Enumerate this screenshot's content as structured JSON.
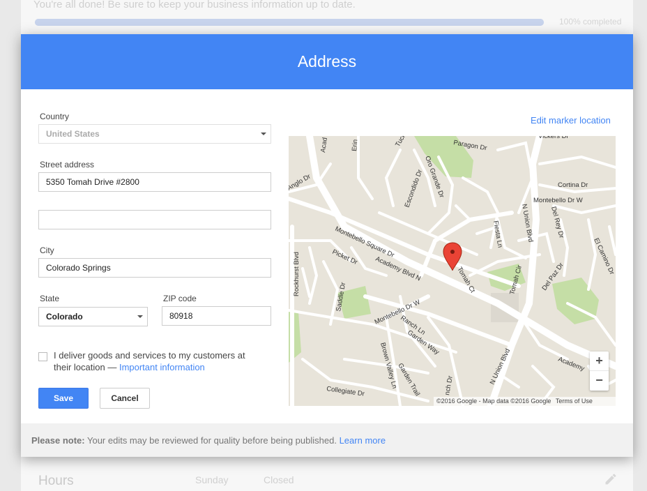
{
  "background": {
    "top_text": "You're all done! Be sure to keep your business information up to date.",
    "progress_percent": 100,
    "progress_label": "100% completed",
    "hours_title": "Hours",
    "hours_day": "Sunday",
    "hours_value": "Closed"
  },
  "dialog": {
    "title": "Address",
    "country": {
      "label": "Country",
      "value": "United States"
    },
    "street": {
      "label": "Street address",
      "value": "5350 Tomah Drive #2800",
      "value2": ""
    },
    "city": {
      "label": "City",
      "value": "Colorado Springs"
    },
    "state": {
      "label": "State",
      "value": "Colorado"
    },
    "zip": {
      "label": "ZIP code",
      "value": "80918"
    },
    "delivery": {
      "text": "I deliver goods and services to my customers at their location —",
      "link": "Important information",
      "checked": false
    },
    "save_label": "Save",
    "cancel_label": "Cancel",
    "edit_marker_label": "Edit marker location",
    "map": {
      "streets": [
        "Academy Blvd N",
        "Montebello Square Dr",
        "Montebello Dr W",
        "Rockhurst Blvd",
        "Picket Dr",
        "Saddle Dr",
        "Ranch Ln",
        "Garden Way",
        "Brown Valley Ln",
        "Garden Trail",
        "Collegiate Dr",
        "N Union Blvd",
        "Tomah Ct",
        "Tomah Cir",
        "Fiesta Ln",
        "Del Rey Dr",
        "Del Paz Dr",
        "El Camino Dr",
        "Cortina Dr",
        "Montebello Dr W",
        "Vickers Dr",
        "Paragon Dr",
        "Oro Grande Dr",
        "Escondido Dr",
        "Tucker",
        "Erin",
        "Acad",
        "Anglo Dr",
        "nch Dr"
      ],
      "credit": "©2016 Google - Map data ©2016 Google",
      "terms": "Terms of Use",
      "marker_color": "#ea4335"
    },
    "note": {
      "bold": "Please note:",
      "text": "Your edits may be reviewed for quality before being published.",
      "link": "Learn more"
    }
  },
  "colors": {
    "accent": "#4285f4",
    "park": "#c5dea6",
    "road": "#ffffff",
    "land": "#e8e4da"
  }
}
